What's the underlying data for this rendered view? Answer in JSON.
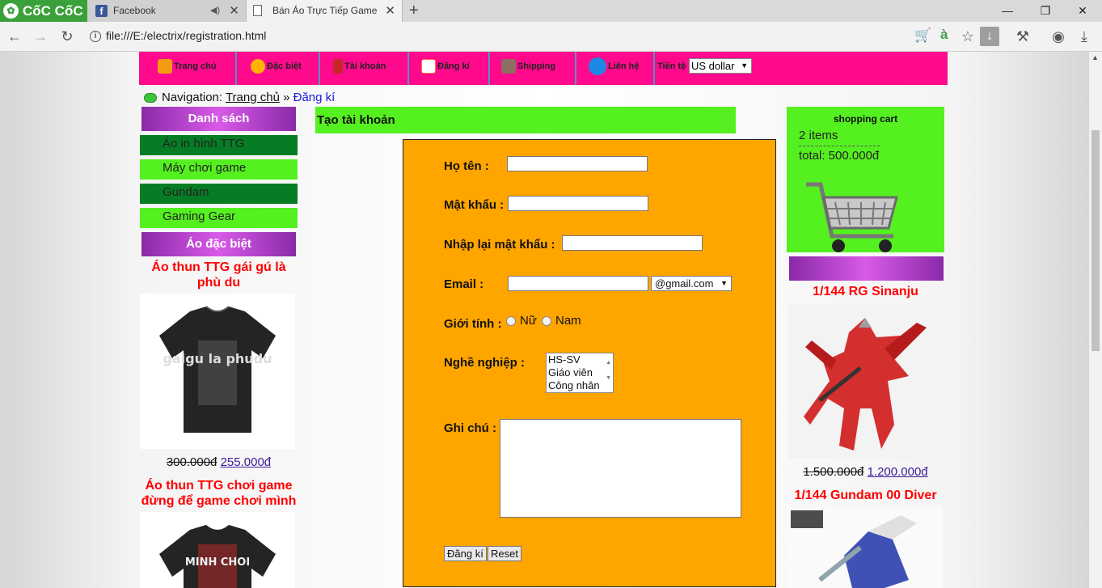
{
  "browser": {
    "brand": "CốC CốC",
    "tabs": [
      {
        "title": "Facebook",
        "active": false
      },
      {
        "title": "Bán Áo Trực Tiếp Game c",
        "active": true
      }
    ],
    "address": "file:///E:/electrix/registration.html",
    "icons": {
      "back": "back-arrow-icon",
      "forward": "forward-arrow-icon",
      "reload": "reload-icon"
    }
  },
  "menu": {
    "items": [
      {
        "label": "Trang chủ",
        "icon": "home-icon",
        "color": "#f39c12"
      },
      {
        "label": "Đặc biệt",
        "icon": "hand-icon",
        "color": "#ffb300"
      },
      {
        "label": "Tài khoản",
        "icon": "user-icon",
        "color": "#c62828"
      },
      {
        "label": "Đăng kí",
        "icon": "register-icon",
        "color": "#ff7043"
      },
      {
        "label": "Shipping",
        "icon": "shipping-icon",
        "color": "#8d6e63"
      },
      {
        "label": "Liên hệ",
        "icon": "phone-icon",
        "color": "#1e88e5"
      }
    ],
    "currency_label": "Tiền tệ",
    "currency_value": "US dollar"
  },
  "breadcrumb": {
    "prefix": "Navigation:",
    "home": "Trang chủ",
    "separator": "»",
    "current": "Đăng kí"
  },
  "left_sidebar": {
    "list_header": "Danh sách",
    "categories": [
      "Áo in hình TTG",
      "Máy chơi game",
      "Gundam",
      "Gaming Gear"
    ],
    "special_header": "Áo đặc biệt",
    "products": [
      {
        "name": "Áo thun TTG gái gú là phù du",
        "old_price": "300.000đ",
        "new_price": "255.000đ",
        "shirt_text": "gaigu la phudu"
      },
      {
        "name": "Áo thun TTG chơi game đừng để game chơi mình",
        "shirt_text": "MINH CHOI"
      }
    ]
  },
  "form": {
    "title": "Tạo tài khoản",
    "labels": {
      "name": "Họ tên :",
      "password": "Mật khẩu :",
      "confirm": "Nhập lại mật khẩu :",
      "email": "Email :",
      "gender": "Giới tính :",
      "job": "Nghề nghiệp :",
      "note": "Ghi chú :"
    },
    "email_domain": "@gmail.com",
    "gender_options": [
      "Nữ",
      "Nam"
    ],
    "job_options": [
      "HS-SV",
      "Giáo viên",
      "Công nhân"
    ],
    "submit": "Đăng kí",
    "reset": "Reset"
  },
  "cart": {
    "title": "shopping cart",
    "items": "2 items",
    "total": "total: 500.000đ"
  },
  "right_sidebar": {
    "products": [
      {
        "name": "1/144 RG Sinanju",
        "old_price": "1.500.000đ",
        "new_price": "1.200.000đ"
      },
      {
        "name": "1/144 Gundam 00 Diver"
      }
    ]
  },
  "colors": {
    "menu_bg": "#ff0a8c",
    "green": "#55f020",
    "dark_green": "#067d24",
    "form_bg": "#ffa500",
    "product_title": "#ff0000"
  }
}
